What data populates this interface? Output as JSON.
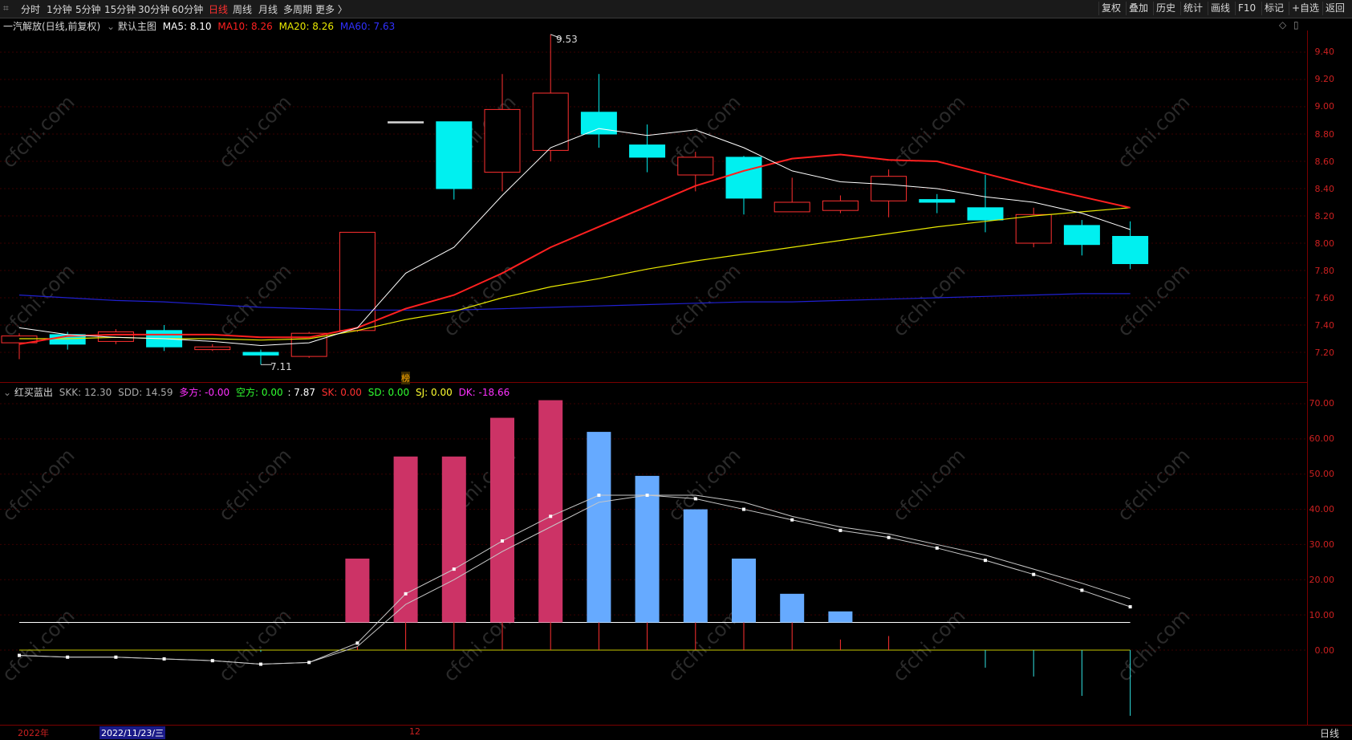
{
  "toolbar": {
    "periods": [
      "分时",
      "1分钟",
      "5分钟",
      "15分钟",
      "30分钟",
      "60分钟",
      "日线",
      "周线",
      "月线",
      "多周期",
      "更多 〉"
    ],
    "active": "日线",
    "right_buttons": [
      "复权",
      "叠加",
      "历史",
      "统计",
      "画线",
      "F10",
      "标记",
      "+自选",
      "返回"
    ]
  },
  "main_legend": {
    "stock": "一汽解放(日线,前复权)",
    "main_chart_label": "默认主图",
    "ma5": "MA5: 8.10",
    "ma10": "MA10: 8.26",
    "ma20": "MA20: 8.26",
    "ma60": "MA60: 7.63"
  },
  "price_axis": [
    "9.40",
    "9.20",
    "9.00",
    "8.80",
    "8.60",
    "8.40",
    "8.20",
    "8.00",
    "7.80",
    "7.60",
    "7.40",
    "7.20"
  ],
  "annotations": {
    "high": "9.53",
    "low": "7.11",
    "rank_label": "榜"
  },
  "sub_legend": {
    "name": "红买蓝出",
    "skk": "SKK: 12.30",
    "sdd": "SDD: 14.59",
    "duofang": "多方: -0.00",
    "kongfang": "空方: 0.00",
    "blank": ": 7.87",
    "sk": "SK: 0.00",
    "sd": "SD: 0.00",
    "sj": "SJ: 0.00",
    "dk": "DK: -18.66"
  },
  "sub_axis": [
    "70.00",
    "60.00",
    "50.00",
    "40.00",
    "30.00",
    "20.00",
    "10.00",
    "0.00"
  ],
  "bottom": {
    "year": "2022年",
    "date": "2022/11/23/三",
    "mark12": "12",
    "period": "日线"
  },
  "watermark": "cfchi.com",
  "colors": {
    "up": "#ff3030",
    "down": "#00f0f0",
    "ma5": "#ffffff",
    "ma10": "#ff2020",
    "ma20": "#e8e800",
    "ma60": "#2020d0",
    "pink": "#cc3366",
    "blue": "#66aaff"
  },
  "chart_data": [
    {
      "type": "candlestick",
      "title": "一汽解放(日线,前复权)",
      "ylim": [
        7.1,
        9.55
      ],
      "candles": [
        {
          "o": 7.27,
          "h": 7.34,
          "l": 7.15,
          "c": 7.32,
          "dir": "up"
        },
        {
          "o": 7.33,
          "h": 7.35,
          "l": 7.22,
          "c": 7.26,
          "dir": "down"
        },
        {
          "o": 7.28,
          "h": 7.37,
          "l": 7.26,
          "c": 7.35,
          "dir": "up"
        },
        {
          "o": 7.36,
          "h": 7.4,
          "l": 7.21,
          "c": 7.24,
          "dir": "down"
        },
        {
          "o": 7.22,
          "h": 7.26,
          "l": 7.21,
          "c": 7.24,
          "dir": "up"
        },
        {
          "o": 7.2,
          "h": 7.22,
          "l": 7.11,
          "c": 7.18,
          "dir": "down"
        },
        {
          "o": 7.17,
          "h": 7.35,
          "l": 7.16,
          "c": 7.34,
          "dir": "up"
        },
        {
          "o": 7.36,
          "h": 8.08,
          "l": 7.35,
          "c": 8.08,
          "dir": "up"
        },
        {
          "o": 8.89,
          "h": 8.89,
          "l": 8.89,
          "c": 8.89,
          "dir": "flat"
        },
        {
          "o": 8.89,
          "h": 8.89,
          "l": 8.32,
          "c": 8.4,
          "dir": "down"
        },
        {
          "o": 8.52,
          "h": 9.24,
          "l": 8.38,
          "c": 8.98,
          "dir": "up"
        },
        {
          "o": 8.68,
          "h": 9.53,
          "l": 8.6,
          "c": 9.1,
          "dir": "up"
        },
        {
          "o": 8.96,
          "h": 9.24,
          "l": 8.7,
          "c": 8.8,
          "dir": "down"
        },
        {
          "o": 8.72,
          "h": 8.87,
          "l": 8.52,
          "c": 8.63,
          "dir": "down"
        },
        {
          "o": 8.5,
          "h": 8.67,
          "l": 8.38,
          "c": 8.63,
          "dir": "up"
        },
        {
          "o": 8.63,
          "h": 8.64,
          "l": 8.21,
          "c": 8.33,
          "dir": "down"
        },
        {
          "o": 8.23,
          "h": 8.48,
          "l": 8.23,
          "c": 8.3,
          "dir": "up"
        },
        {
          "o": 8.24,
          "h": 8.35,
          "l": 8.22,
          "c": 8.31,
          "dir": "up"
        },
        {
          "o": 8.31,
          "h": 8.54,
          "l": 8.19,
          "c": 8.49,
          "dir": "up"
        },
        {
          "o": 8.32,
          "h": 8.36,
          "l": 8.22,
          "c": 8.3,
          "dir": "down"
        },
        {
          "o": 8.26,
          "h": 8.5,
          "l": 8.08,
          "c": 8.17,
          "dir": "down"
        },
        {
          "o": 8.0,
          "h": 8.26,
          "l": 7.97,
          "c": 8.21,
          "dir": "up"
        },
        {
          "o": 8.13,
          "h": 8.17,
          "l": 7.91,
          "c": 7.99,
          "dir": "down"
        },
        {
          "o": 8.05,
          "h": 8.16,
          "l": 7.81,
          "c": 7.85,
          "dir": "down"
        }
      ],
      "ma5": [
        7.38,
        7.33,
        7.31,
        7.3,
        7.28,
        7.25,
        7.27,
        7.38,
        7.78,
        7.97,
        8.35,
        8.7,
        8.84,
        8.79,
        8.83,
        8.7,
        8.53,
        8.45,
        8.43,
        8.4,
        8.34,
        8.3,
        8.22,
        8.1
      ],
      "ma10": [
        7.26,
        7.32,
        7.33,
        7.33,
        7.33,
        7.31,
        7.31,
        7.38,
        7.52,
        7.62,
        7.78,
        7.97,
        8.12,
        8.27,
        8.42,
        8.53,
        8.62,
        8.65,
        8.61,
        8.6,
        8.51,
        8.42,
        8.34,
        8.26
      ],
      "ma20": [
        7.3,
        7.3,
        7.31,
        7.3,
        7.3,
        7.29,
        7.3,
        7.36,
        7.44,
        7.5,
        7.6,
        7.68,
        7.74,
        7.81,
        7.87,
        7.92,
        7.97,
        8.02,
        8.07,
        8.12,
        8.16,
        8.2,
        8.23,
        8.26
      ],
      "ma60": [
        7.62,
        7.6,
        7.58,
        7.57,
        7.55,
        7.53,
        7.52,
        7.51,
        7.51,
        7.51,
        7.52,
        7.53,
        7.54,
        7.55,
        7.56,
        7.57,
        7.57,
        7.58,
        7.59,
        7.6,
        7.61,
        7.62,
        7.63,
        7.63
      ]
    },
    {
      "type": "bar",
      "title": "红买蓝出",
      "ylim": [
        -12,
        72
      ],
      "bars": [
        {
          "i": 7,
          "v": 26,
          "color": "pink"
        },
        {
          "i": 8,
          "v": 55,
          "color": "pink"
        },
        {
          "i": 9,
          "v": 55,
          "color": "pink"
        },
        {
          "i": 10,
          "v": 66,
          "color": "pink"
        },
        {
          "i": 11,
          "v": 71,
          "color": "pink"
        },
        {
          "i": 12,
          "v": 62,
          "color": "blue"
        },
        {
          "i": 13,
          "v": 49.5,
          "color": "blue"
        },
        {
          "i": 14,
          "v": 40,
          "color": "blue"
        },
        {
          "i": 15,
          "v": 26,
          "color": "blue"
        },
        {
          "i": 16,
          "v": 16,
          "color": "blue"
        },
        {
          "i": 17,
          "v": 11,
          "color": "blue"
        }
      ],
      "sticks": [
        0,
        0,
        0,
        0,
        0,
        -0.5,
        0,
        1,
        8,
        8,
        8,
        8,
        8,
        8,
        8,
        8,
        8,
        3,
        4,
        0,
        -5,
        -7.5,
        -13,
        -18.66
      ],
      "line1": [
        -1.5,
        -2,
        -2,
        -2.5,
        -3,
        -4,
        -3.5,
        2,
        16,
        23,
        31,
        38,
        44,
        44,
        43,
        40,
        37,
        34,
        32,
        29,
        25.5,
        21.5,
        17,
        12.3
      ],
      "line2": [
        -1.5,
        -2,
        -2,
        -2.5,
        -3,
        -4,
        -3.5,
        1,
        13,
        20,
        28,
        35,
        42,
        44,
        44,
        42,
        38,
        35,
        33,
        30,
        27,
        23,
        19,
        14.59
      ],
      "ref_line": 7.87
    }
  ]
}
